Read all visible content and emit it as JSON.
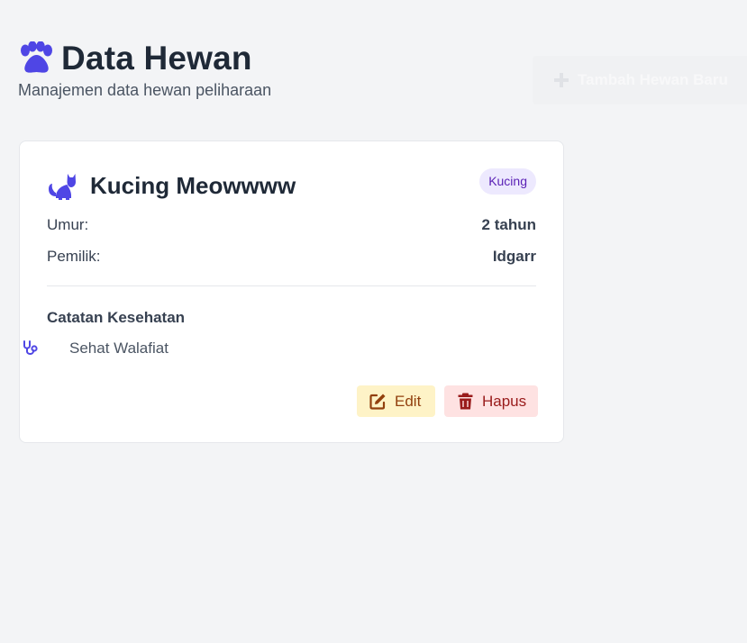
{
  "header": {
    "title": "Data Hewan",
    "subtitle": "Manajemen data hewan peliharaan",
    "icon": "paw-icon"
  },
  "background_button": {
    "label": "Tambah Hewan Baru",
    "icon": "plus-icon"
  },
  "card": {
    "icon": "cat-icon",
    "name": "Kucing Meowwww",
    "species": "Kucing",
    "age_label": "Umur:",
    "age_value": "2 tahun",
    "owner_label": "Pemilik:",
    "owner_value": "Idgarr",
    "health_heading": "Catatan Kesehatan",
    "health_icon": "stethoscope-icon",
    "health_note": "Sehat Walafiat",
    "edit_label": "Edit",
    "edit_icon": "edit-icon",
    "delete_label": "Hapus",
    "delete_icon": "trash-icon"
  },
  "colors": {
    "accent": "#4f46e5",
    "badge_bg": "#ede9fe",
    "badge_text": "#5b21b6",
    "edit_bg": "#fef3c7",
    "edit_text": "#92400e",
    "delete_bg": "#fee2e2",
    "delete_text": "#991b1b"
  }
}
